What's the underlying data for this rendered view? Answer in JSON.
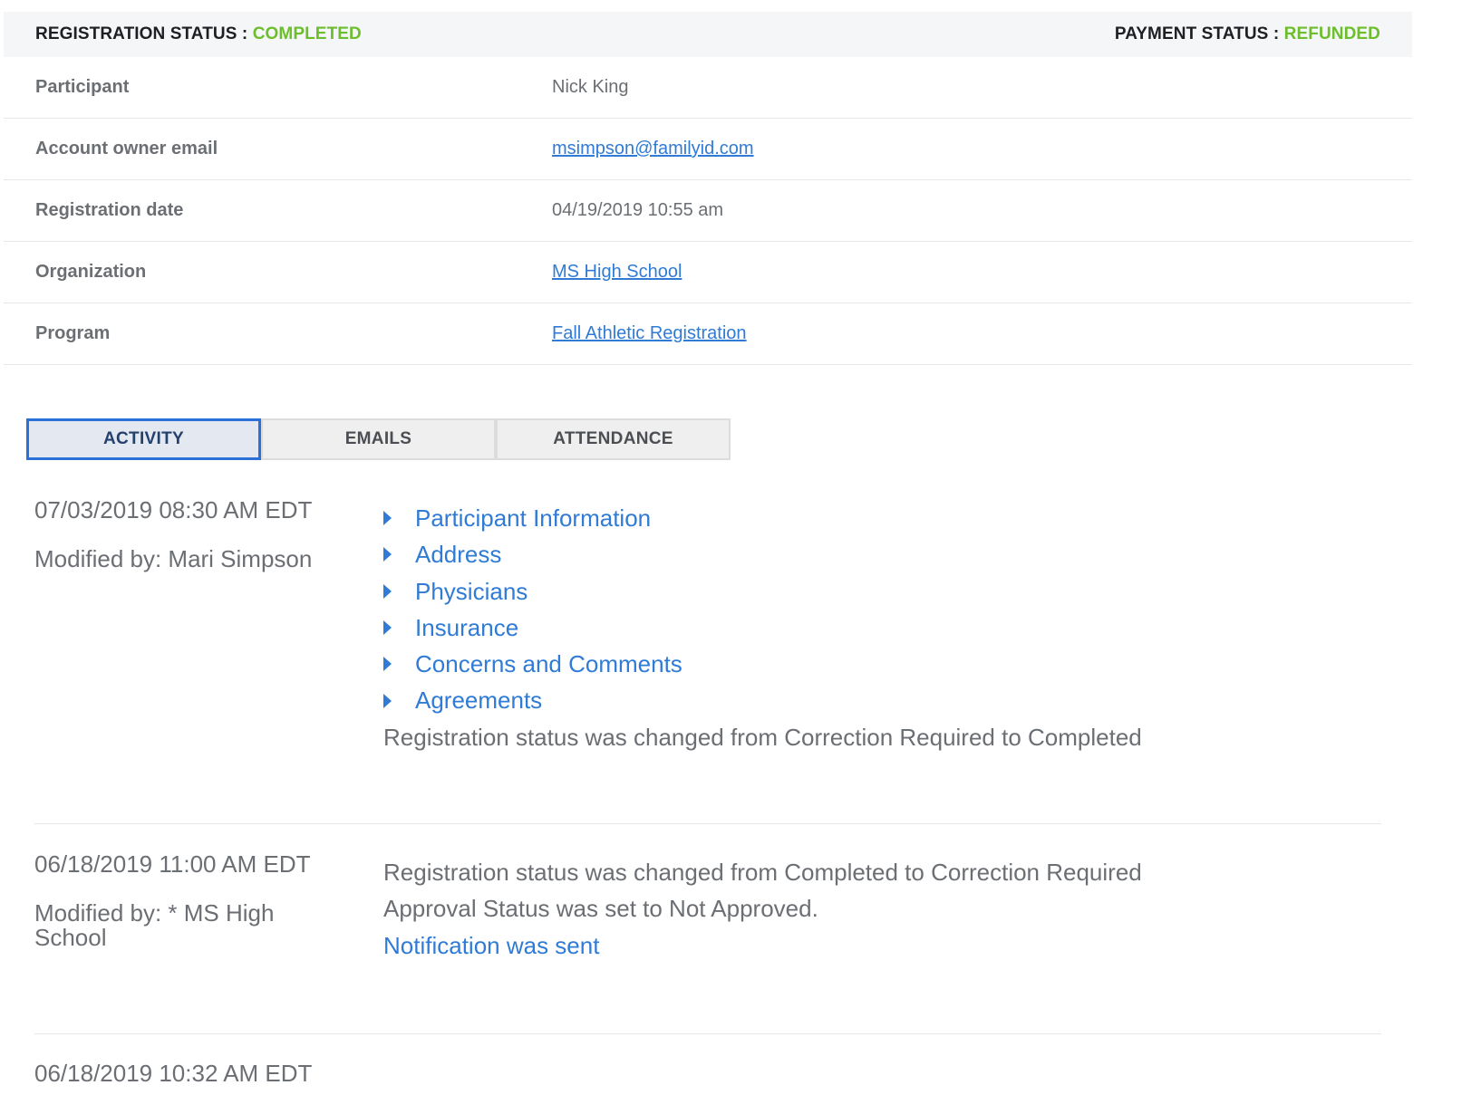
{
  "status_bar": {
    "registration_label": "REGISTRATION STATUS : ",
    "registration_value": "COMPLETED",
    "payment_label": "PAYMENT STATUS : ",
    "payment_value": "REFUNDED",
    "status_color": "#6cbe2c"
  },
  "details": {
    "participant": {
      "label": "Participant",
      "value": "Nick King"
    },
    "email": {
      "label": "Account owner email",
      "value": "msimpson@familyid.com"
    },
    "registration_date": {
      "label": "Registration date",
      "value": "04/19/2019 10:55 am"
    },
    "organization": {
      "label": "Organization",
      "value": "MS High School"
    },
    "program": {
      "label": "Program",
      "value": "Fall Athletic Registration"
    }
  },
  "tabs": {
    "activity": "ACTIVITY",
    "emails": "EMAILS",
    "attendance": "ATTENDANCE",
    "active": "ACTIVITY"
  },
  "activity": [
    {
      "date": "07/03/2019 08:30 AM EDT",
      "modified_by": "Modified by: Mari Simpson",
      "sections": [
        "Participant Information",
        "Address",
        "Physicians",
        "Insurance",
        "Concerns and Comments",
        "Agreements"
      ],
      "status_change": "Registration status was changed from Correction Required to Completed"
    },
    {
      "date": "06/18/2019 11:00 AM EDT",
      "modified_by": "Modified by: * MS High School",
      "status_change": "Registration status was changed from Completed to Correction Required",
      "approval": "Approval Status was set to Not Approved.",
      "notification": "Notification was sent"
    },
    {
      "date": "06/18/2019 10:32 AM EDT"
    }
  ],
  "colors": {
    "link": "#2f7bd6",
    "active_tab_border": "#2b6fd8"
  }
}
